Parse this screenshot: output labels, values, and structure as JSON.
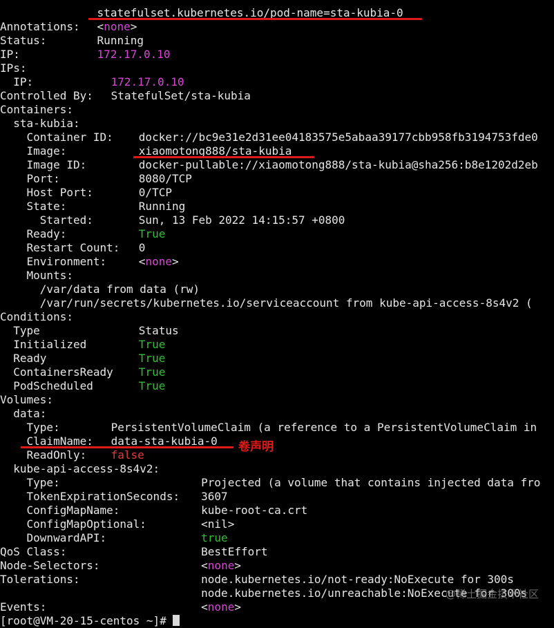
{
  "lines": [
    {
      "label": "",
      "value": "statefulset.kubernetes.io/pod-name=sta-kubia-0",
      "value_indent": 14,
      "color": "default"
    },
    {
      "label": "Annotations:",
      "value": "<none>",
      "value_indent": 14,
      "color": "none"
    },
    {
      "label": "Status:",
      "value": "Running",
      "value_indent": 14,
      "color": "default"
    },
    {
      "label": "IP:",
      "value": "172.17.0.10",
      "value_indent": 14,
      "color": "magenta"
    },
    {
      "label": "IPs:",
      "value": "",
      "value_indent": 14,
      "color": "default"
    },
    {
      "label": "  IP:",
      "value": "172.17.0.10",
      "value_indent": 16,
      "color": "magenta"
    },
    {
      "label": "Controlled By:",
      "value": "StatefulSet/sta-kubia",
      "value_indent": 16,
      "color": "default"
    },
    {
      "label": "Containers:",
      "value": "",
      "value_indent": 16,
      "color": "default"
    },
    {
      "label": "  sta-kubia:",
      "value": "",
      "value_indent": 16,
      "color": "default"
    },
    {
      "label": "    Container ID:",
      "value": "docker://bc9e31e2d31ee04183575e5abaa39177cbb958fb3194753fde0",
      "value_indent": 20,
      "color": "default"
    },
    {
      "label": "    Image:",
      "value": "xiaomotong888/sta-kubia",
      "value_indent": 20,
      "color": "default"
    },
    {
      "label": "    Image ID:",
      "value": "docker-pullable://xiaomotong888/sta-kubia@sha256:b8e1202d2eb",
      "value_indent": 20,
      "color": "default"
    },
    {
      "label": "    Port:",
      "value": "8080/TCP",
      "value_indent": 20,
      "color": "default"
    },
    {
      "label": "    Host Port:",
      "value": "0/TCP",
      "value_indent": 20,
      "color": "default"
    },
    {
      "label": "    State:",
      "value": "Running",
      "value_indent": 20,
      "color": "default"
    },
    {
      "label": "      Started:",
      "value": "Sun, 13 Feb 2022 14:15:57 +0800",
      "value_indent": 20,
      "color": "default"
    },
    {
      "label": "    Ready:",
      "value": "True",
      "value_indent": 20,
      "color": "green"
    },
    {
      "label": "    Restart Count:",
      "value": "0",
      "value_indent": 20,
      "color": "default"
    },
    {
      "label": "    Environment:",
      "value": "<none>",
      "value_indent": 20,
      "color": "none"
    },
    {
      "label": "    Mounts:",
      "value": "",
      "value_indent": 20,
      "color": "default"
    },
    {
      "label": "      /var/data from data (rw)",
      "value": "",
      "value_indent": 20,
      "color": "default"
    },
    {
      "label": "      /var/run/secrets/kubernetes.io/serviceaccount from kube-api-access-8s4v2 (",
      "value": "",
      "value_indent": 20,
      "color": "default"
    },
    {
      "label": "Conditions:",
      "value": "",
      "value_indent": 20,
      "color": "default"
    },
    {
      "label": "  Type",
      "value": "Status",
      "value_indent": 20,
      "color": "default"
    },
    {
      "label": "  Initialized",
      "value": "True",
      "value_indent": 20,
      "color": "green"
    },
    {
      "label": "  Ready",
      "value": "True",
      "value_indent": 20,
      "color": "green"
    },
    {
      "label": "  ContainersReady",
      "value": "True",
      "value_indent": 20,
      "color": "green"
    },
    {
      "label": "  PodScheduled",
      "value": "True",
      "value_indent": 20,
      "color": "green"
    },
    {
      "label": "Volumes:",
      "value": "",
      "value_indent": 20,
      "color": "default"
    },
    {
      "label": "  data:",
      "value": "",
      "value_indent": 20,
      "color": "default"
    },
    {
      "label": "    Type:",
      "value": "PersistentVolumeClaim (a reference to a PersistentVolumeClaim in",
      "value_indent": 16,
      "color": "default"
    },
    {
      "label": "    ClaimName:",
      "value": "data-sta-kubia-0",
      "value_indent": 16,
      "color": "default"
    },
    {
      "label": "    ReadOnly:",
      "value": "false",
      "value_indent": 16,
      "color": "red"
    },
    {
      "label": "  kube-api-access-8s4v2:",
      "value": "",
      "value_indent": 16,
      "color": "default"
    },
    {
      "label": "    Type:",
      "value": "Projected (a volume that contains injected data fro",
      "value_indent": 29,
      "color": "default"
    },
    {
      "label": "    TokenExpirationSeconds:",
      "value": "3607",
      "value_indent": 29,
      "color": "default"
    },
    {
      "label": "    ConfigMapName:",
      "value": "kube-root-ca.crt",
      "value_indent": 29,
      "color": "default"
    },
    {
      "label": "    ConfigMapOptional:",
      "value": "<nil>",
      "value_indent": 29,
      "color": "default"
    },
    {
      "label": "    DownwardAPI:",
      "value": "true",
      "value_indent": 29,
      "color": "green"
    },
    {
      "label": "QoS Class:",
      "value": "BestEffort",
      "value_indent": 29,
      "color": "default"
    },
    {
      "label": "Node-Selectors:",
      "value": "<none>",
      "value_indent": 29,
      "color": "none"
    },
    {
      "label": "Tolerations:",
      "value": "node.kubernetes.io/not-ready:NoExecute for 300s",
      "value_indent": 29,
      "color": "default"
    },
    {
      "label": "",
      "value": "node.kubernetes.io/unreachable:NoExecute for 300s",
      "value_indent": 29,
      "color": "default"
    },
    {
      "label": "Events:",
      "value": "<none>",
      "value_indent": 29,
      "color": "none"
    },
    {
      "label": "[root@VM-20-15-centos ~]# ",
      "value": "",
      "value_indent": 29,
      "color": "default"
    }
  ],
  "annotation": {
    "text": "卷声明"
  },
  "watermark": {
    "text": "@稀土掘金技术社区"
  },
  "colors": {
    "background": "#000000",
    "text": "#e6e6e6",
    "magenta": "#d845d8",
    "green": "#2fc12f",
    "red": "#e03c3c",
    "marker": "#e01818"
  }
}
